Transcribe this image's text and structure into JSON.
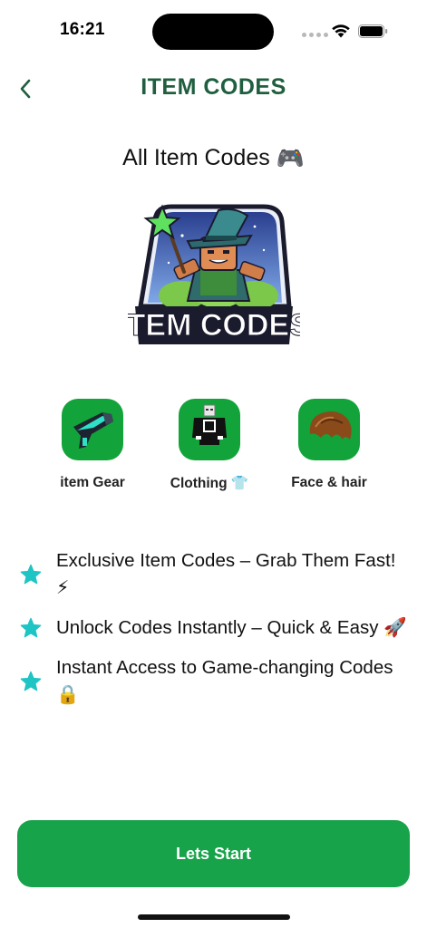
{
  "status_bar": {
    "time": "16:21"
  },
  "header": {
    "title": "ITEM CODES"
  },
  "section": {
    "title": "All Item Codes",
    "title_emoji": "🎮"
  },
  "logo": {
    "text": "ITEM CODES"
  },
  "categories": [
    {
      "label": "item Gear",
      "icon": "gun-icon"
    },
    {
      "label": "Clothing 👕",
      "icon": "shirt-icon"
    },
    {
      "label": "Face & hair",
      "icon": "hair-icon"
    }
  ],
  "features": [
    {
      "text": "Exclusive Item Codes – Grab Them Fast! ⚡"
    },
    {
      "text": "Unlock Codes Instantly – Quick & Easy 🚀"
    },
    {
      "text": "Instant Access to Game-changing Codes 🔒"
    }
  ],
  "cta": {
    "label": "Lets Start"
  },
  "colors": {
    "accent_green": "#17a34a",
    "title_green": "#1f5f3f",
    "star_teal": "#1fc4c4"
  }
}
